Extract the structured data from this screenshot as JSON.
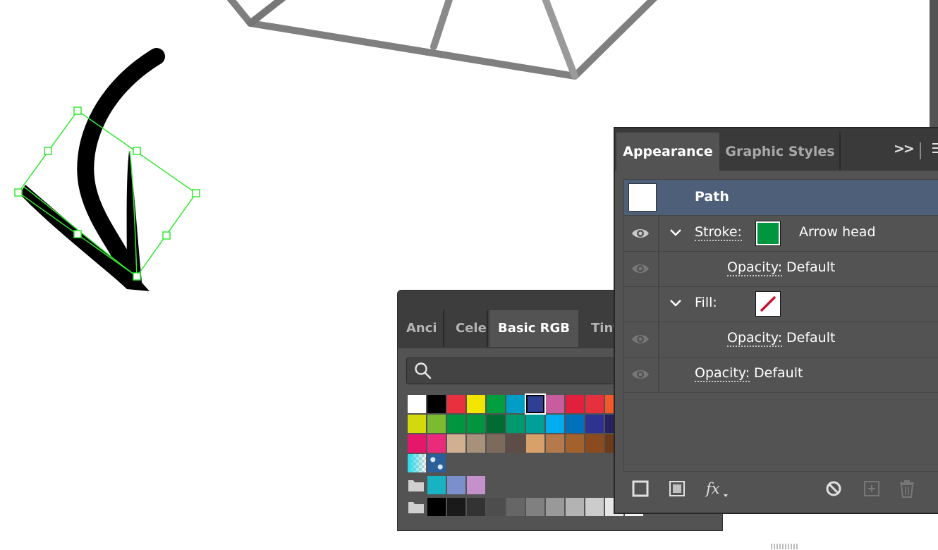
{
  "swatches_panel": {
    "tabs": [
      "Anci",
      "Cele",
      "Basic RGB",
      "Tint"
    ],
    "active_tab": "Basic RGB",
    "search": {
      "placeholder": "",
      "value": ""
    },
    "rows": [
      [
        "#ffffff",
        "#000000",
        "#e8303f",
        "#f2e600",
        "#00a03e",
        "#009ec6",
        "#2e3f94",
        "#c85c9d",
        "#e21f3d",
        "#e6303e",
        "#f05a28"
      ],
      [
        "#d4d90d",
        "#7abb31",
        "#00963f",
        "#00963f",
        "#006b32",
        "#009a6e",
        "#00a098",
        "#00aeef",
        "#0071bb",
        "#2e3290",
        "#262262"
      ],
      [
        "#e5176b",
        "#ea2a7b",
        "#d1b092",
        "#a7917a",
        "#7c6a5d",
        "#5d4d46",
        "#d8a16a",
        "#b57a4b",
        "#a2612d",
        "#8b4b1f",
        "#6d3b17"
      ]
    ],
    "selected_swatch": "#2e3f94",
    "pattern_swatches": [
      "gradient-checker",
      "blue-floral-pattern"
    ],
    "group1": [
      "#17b3c3",
      "#7b8fcd",
      "#c591cd"
    ],
    "group2": [
      "#000000",
      "#1a1a1a",
      "#333333",
      "#4d4d4d",
      "#666666",
      "#808080",
      "#999999",
      "#b3b3b3",
      "#cccccc",
      "#e6e6e6",
      "#f2f2f2"
    ]
  },
  "appearance_panel": {
    "tabs": [
      "Appearance",
      "Graphic Styles"
    ],
    "active_tab": "Appearance",
    "more_label": ">>",
    "object": {
      "label": "Path"
    },
    "rows": {
      "stroke": {
        "label": "Stroke:",
        "color": "#00963f",
        "value": "Arrow head"
      },
      "stroke_opacity": {
        "label": "Opacity:",
        "value": "Default"
      },
      "fill": {
        "label": "Fill:",
        "value": "none"
      },
      "fill_opacity": {
        "label": "Opacity:",
        "value": "Default"
      },
      "opacity": {
        "label": "Opacity:",
        "value": "Default"
      }
    },
    "footer_icons": [
      "add-new-stroke-icon",
      "add-new-fill-icon",
      "fx-icon",
      "clear-appearance-icon",
      "duplicate-item-icon",
      "delete-item-icon"
    ]
  },
  "colors": {
    "selection": "#33e833",
    "panel_bg": "#535353",
    "panel_dark": "#3a3a3a",
    "highlight_row": "#4e6079"
  }
}
